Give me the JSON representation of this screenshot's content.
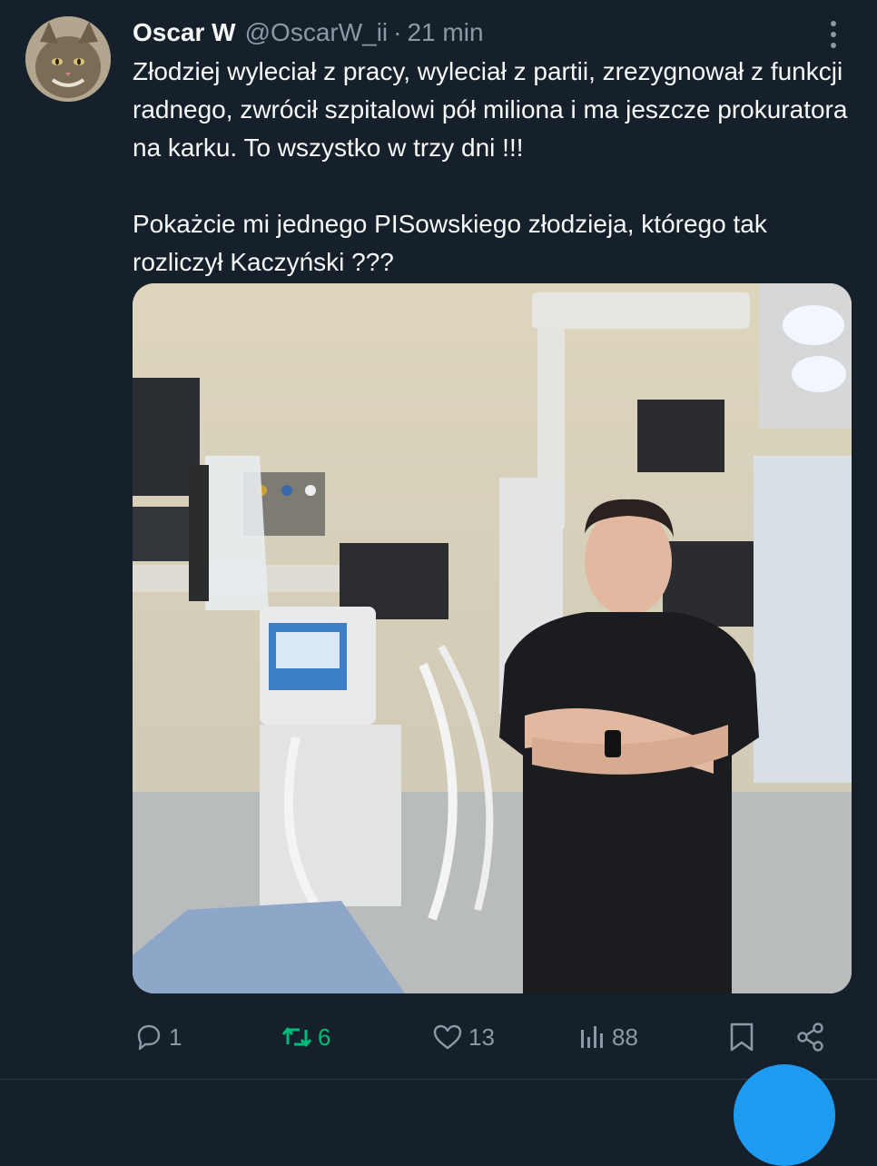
{
  "tweet": {
    "author_name": "Oscar W",
    "author_handle": "@OscarW_ii",
    "separator": "·",
    "time": "21 min",
    "text_paragraph_1": "Złodziej wyleciał z pracy, wyleciał z partii, zrezygnował z funkcji radnego, zwrócił szpitalowi pół miliona i ma jeszcze prokuratora na karku. To wszystko w trzy dni !!!",
    "text_paragraph_2": "Pokażcie mi jednego PISowskiego złodzieja, którego tak rozliczył Kaczyński ???",
    "avatar_icon": "cat-avatar",
    "more_icon": "vertical-dots-icon"
  },
  "actions": {
    "reply_count": "1",
    "retweet_count": "6",
    "like_count": "13",
    "views_count": "88"
  },
  "colors": {
    "background": "#15202b",
    "text": "#f7f9f9",
    "muted": "#8b98a5",
    "retweet_active": "#00ba7c",
    "accent": "#1d9bf0"
  }
}
